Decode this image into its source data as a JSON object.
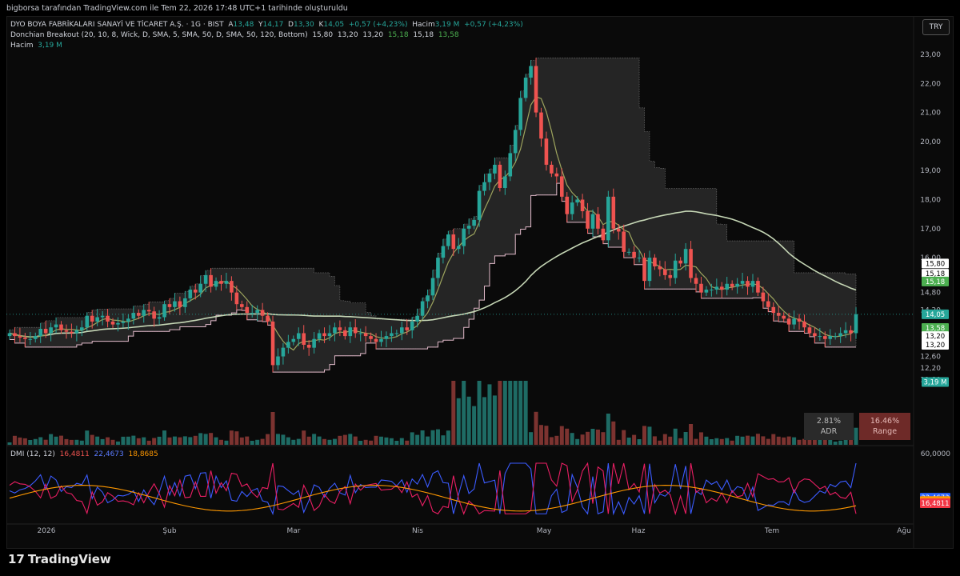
{
  "header": {
    "attribution": "bigborsa tarafından TradingView.com ile Tem 22, 2026 17:48 UTC+1 tarihinde oluşturuldu"
  },
  "legend": {
    "symbol": "DYO BOYA FABRİKALARI SANAYİ VE TİCARET A.Ş. · 1G · BIST",
    "o_lbl": "A",
    "o_val": "13,48",
    "h_lbl": "Y",
    "h_val": "14,17",
    "l_lbl": "D",
    "l_val": "13,30",
    "c_lbl": "K",
    "c_val": "14,05",
    "chg": "+0,57 (+4,23%)",
    "vol_lbl": "Hacim",
    "vol_val": "3,19 M",
    "vol_chg": "+0,57 (+4,23%)",
    "donchian_name": "Donchian Breakout (20, 10, 8, Wick, D, SMA, 5, SMA, 50, D, SMA, 50, 120, Bottom)",
    "donchian_vals": [
      "15,80",
      "13,20",
      "13,20",
      "15,18",
      "15,18",
      "13,58"
    ],
    "volume_name": "Hacim",
    "volume_val": "3,19 M",
    "dmi_name": "DMI (12, 12)",
    "dmi_vals": [
      "16,4811",
      "22,4673",
      "18,8685"
    ]
  },
  "currency_button": "TRY",
  "adr": {
    "pct": "2.81%",
    "label": "ADR"
  },
  "range": {
    "pct": "16.46%",
    "label": "Range"
  },
  "brand": "TradingView",
  "colors": {
    "up": "#26a69a",
    "down": "#ef5350",
    "vol_up": "#1e6b64",
    "vol_down": "#7c3330",
    "channel": "#2a2a2a",
    "sma_fast": "#9ca35d",
    "sma_slow": "#c5d6b5",
    "dmi_plus": "#3b5bff",
    "dmi_minus": "#e91e63",
    "adx": "#ff9800"
  },
  "chart_data": {
    "type": "candlestick",
    "price_ticks": [
      "23,00",
      "22,00",
      "21,00",
      "20,00",
      "19,00",
      "18,00",
      "17,00",
      "16,00",
      "14,80",
      "14,20",
      "12,60",
      "12,20",
      "11,80"
    ],
    "dmi_ticks": [
      "60,0000",
      "8,0000"
    ],
    "x_ticks": [
      "2026",
      "Şub",
      "Mar",
      "Nis",
      "May",
      "Haz",
      "Tem",
      "Ağu"
    ],
    "price_labels": [
      {
        "text": "15,80",
        "style": "white",
        "value": 15.8
      },
      {
        "text": "15,18",
        "style": "white",
        "value": 15.45
      },
      {
        "text": "15,18",
        "style": "green",
        "value": 15.18
      },
      {
        "text": "14,05",
        "style": "teal",
        "value": 14.05
      },
      {
        "text": "13,58",
        "style": "green",
        "value": 13.58
      },
      {
        "text": "13,20",
        "style": "white",
        "value": 13.3
      },
      {
        "text": "13,20",
        "style": "white",
        "value": 13.0
      },
      {
        "text": "3,19 M",
        "style": "teal",
        "value": 11.72
      }
    ],
    "dmi_labels": [
      {
        "text": "22,4673",
        "style": "blue",
        "value": 22.47
      },
      {
        "text": "18,8685",
        "style": "orange",
        "value": 18.87
      },
      {
        "text": "16,4811",
        "style": "red",
        "value": 16.48
      }
    ],
    "closes": [
      13.4,
      13.3,
      13.25,
      13.2,
      13.2,
      13.3,
      13.55,
      13.4,
      13.6,
      13.7,
      13.5,
      13.45,
      13.4,
      13.5,
      13.6,
      14.0,
      13.8,
      13.95,
      14.0,
      13.8,
      13.7,
      13.75,
      13.8,
      13.9,
      14.1,
      14.0,
      14.2,
      14.15,
      13.9,
      13.95,
      14.4,
      14.3,
      14.5,
      14.3,
      14.6,
      14.9,
      14.8,
      15.1,
      15.4,
      15.0,
      15.2,
      15.1,
      15.2,
      14.8,
      14.4,
      14.3,
      14.1,
      14.1,
      14.2,
      14.0,
      13.8,
      12.3,
      12.6,
      12.9,
      13.1,
      13.2,
      13.4,
      13.0,
      12.9,
      13.2,
      13.4,
      13.3,
      13.4,
      13.6,
      13.5,
      13.3,
      13.6,
      13.4,
      13.4,
      13.3,
      13.2,
      13.1,
      13.2,
      13.3,
      13.4,
      13.4,
      13.6,
      13.5,
      13.8,
      14.0,
      14.5,
      14.7,
      15.3,
      16.0,
      16.4,
      16.8,
      16.3,
      16.4,
      17.0,
      17.1,
      17.3,
      18.3,
      18.6,
      18.9,
      19.2,
      18.4,
      18.8,
      19.6,
      20.4,
      21.5,
      22.2,
      22.6,
      21.0,
      20.1,
      19.2,
      18.9,
      18.8,
      18.1,
      17.5,
      17.9,
      18.0,
      17.6,
      17.0,
      17.5,
      17.0,
      16.6,
      18.1,
      17.0,
      16.9,
      16.2,
      16.2,
      16.0,
      16.0,
      15.2,
      16.0,
      15.7,
      15.6,
      15.4,
      15.3,
      15.9,
      15.8,
      16.3,
      15.3,
      15.1,
      14.8,
      14.9,
      14.9,
      15.0,
      14.9,
      15.1,
      15.0,
      15.1,
      15.2,
      15.0,
      15.2,
      14.8,
      14.5,
      14.3,
      14.1,
      14.0,
      13.9,
      13.7,
      13.9,
      13.8,
      13.6,
      13.4,
      13.3,
      13.3,
      13.2,
      13.3,
      13.3,
      13.4,
      13.5,
      13.4,
      14.05
    ]
  }
}
